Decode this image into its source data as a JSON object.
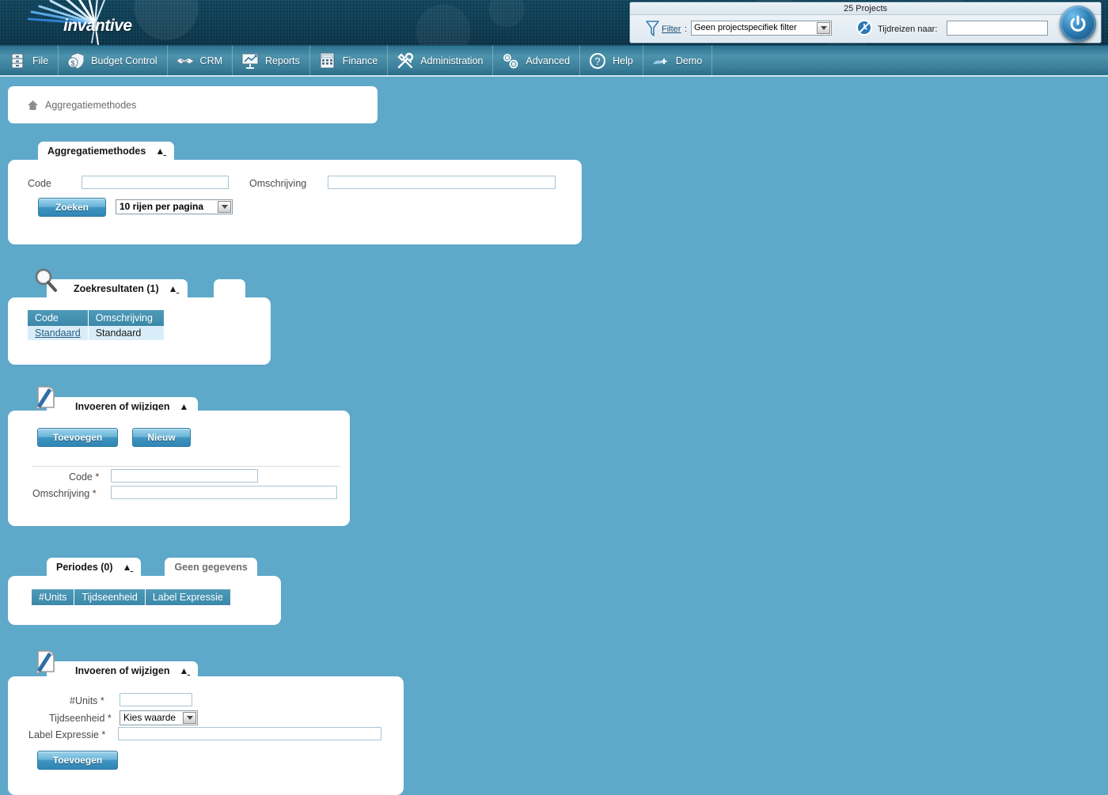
{
  "header": {
    "logo_text": "invantive",
    "top_panel": {
      "title": "25 Projects",
      "filter_icon": "funnel-icon",
      "filter_label": "Filter",
      "filter_colon": ":",
      "filter_value": "Geen projectspecifiek filter",
      "clock_icon": "time-travel-icon",
      "timetravel_label": "Tijdreizen naar:",
      "timetravel_value": "",
      "power_icon": "power-icon"
    }
  },
  "menu": {
    "items": [
      {
        "label": "File",
        "icon": "cabinet-icon"
      },
      {
        "label": "Budget Control",
        "icon": "money-shield-icon"
      },
      {
        "label": "CRM",
        "icon": "handshake-icon"
      },
      {
        "label": "Reports",
        "icon": "presentation-chart-icon"
      },
      {
        "label": "Finance",
        "icon": "calculator-icon"
      },
      {
        "label": "Administration",
        "icon": "tools-icon"
      },
      {
        "label": "Advanced",
        "icon": "gears-icon"
      },
      {
        "label": "Help",
        "icon": "question-circle-icon"
      },
      {
        "label": "Demo",
        "icon": "user-add-icon"
      }
    ]
  },
  "breadcrumb": {
    "home_icon": "home-icon",
    "label": "Aggregatiemethodes"
  },
  "search_panel": {
    "tab_title": "Aggregatiemethodes",
    "collapse_icon": "chevron-up-icon",
    "code_label": "Code",
    "code_value": "",
    "omschrijving_label": "Omschrijving",
    "omschrijving_value": "",
    "search_button": "Zoeken",
    "rows_per_page": "10 rijen per pagina"
  },
  "results_panel": {
    "tab_title": "Zoekresultaten (1)",
    "tab_icon": "magnifier-icon",
    "collapse_icon": "chevron-up-icon",
    "columns": [
      "Code",
      "Omschrijving"
    ],
    "rows": [
      {
        "code": "Standaard",
        "omschrijving": "Standaard"
      }
    ]
  },
  "edit_panel_1": {
    "tab_title": "Invoeren of wijzigen",
    "tab_icon": "document-pen-icon",
    "collapse_icon": "chevron-up-icon",
    "add_button": "Toevoegen",
    "new_button": "Nieuw",
    "code_label": "Code *",
    "code_value": "",
    "omschrijving_label": "Omschrijving *",
    "omschrijving_value": ""
  },
  "periods_panel": {
    "tab_title": "Periodes (0)",
    "collapse_icon": "chevron-up-icon",
    "secondary_tab": "Geen gegevens",
    "columns": [
      "#Units",
      "Tijdseenheid",
      "Label Expressie"
    ],
    "rows": []
  },
  "edit_panel_2": {
    "tab_title": "Invoeren of wijzigen",
    "tab_icon": "document-pen-icon",
    "collapse_icon": "chevron-up-icon",
    "units_label": "#Units *",
    "units_value": "",
    "tijdseenheid_label": "Tijdseenheid *",
    "tijdseenheid_value": "Kies waarde",
    "label_expressie_label": "Label Expressie *",
    "label_expressie_value": "",
    "add_button": "Toevoegen"
  },
  "colors": {
    "page_background": "#5EA8CA",
    "header_dark": "#0C3A50",
    "menu_teal": "#3B7F9B",
    "grid_header": "#3F8CAB",
    "grid_row": "#D9EDF9",
    "button_blue": "#3F93BF"
  }
}
